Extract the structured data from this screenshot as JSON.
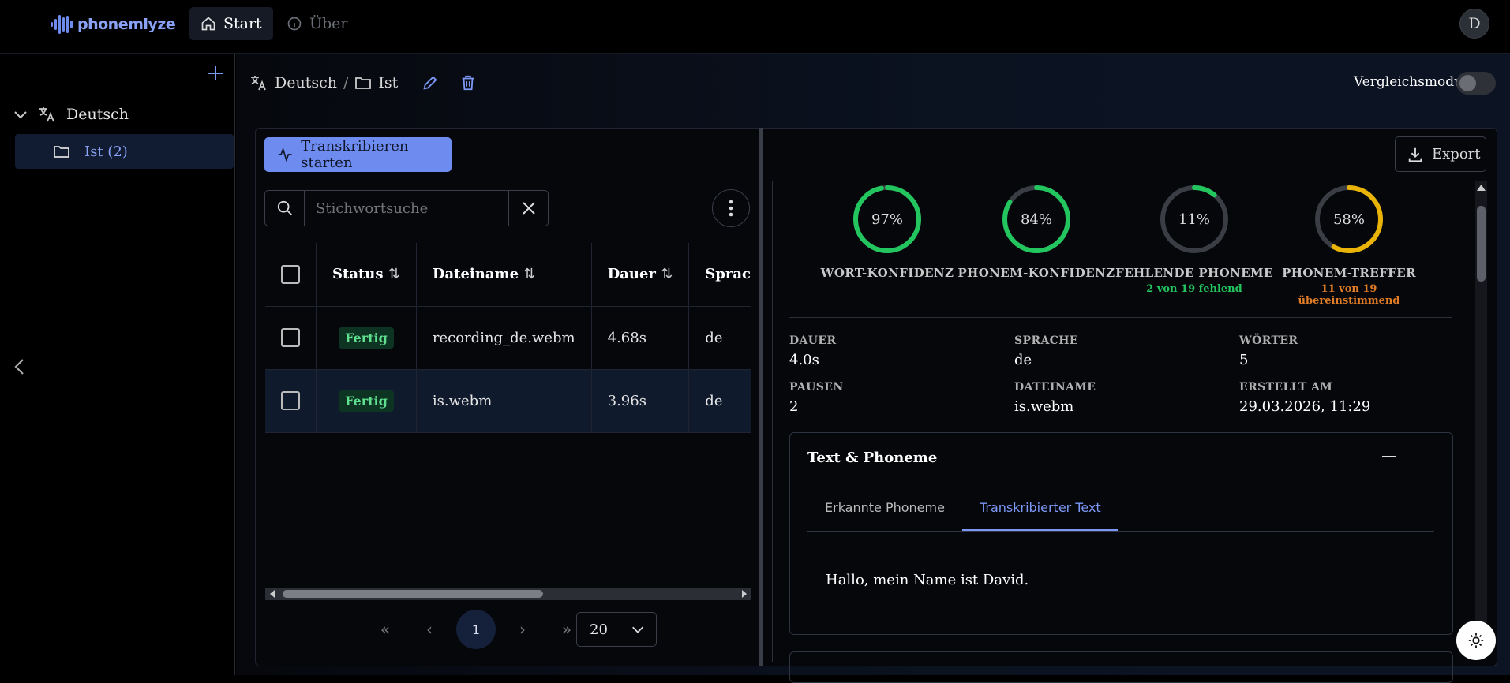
{
  "app": {
    "logo_text": "phonemlyze",
    "avatar_initial": "D"
  },
  "nav": {
    "start": "Start",
    "about": "Über"
  },
  "sidebar": {
    "language": "Deutsch",
    "folder_label": "Ist (2)"
  },
  "breadcrumb": {
    "language": "Deutsch",
    "separator": "/",
    "folder": "Ist"
  },
  "compare": {
    "label": "Vergleichsmodus",
    "enabled": false
  },
  "toolbar": {
    "transcribe_label": "Transkribieren starten",
    "search_placeholder": "Stichwortsuche"
  },
  "table": {
    "headers": [
      "Status",
      "Dateiname",
      "Dauer",
      "Sprache"
    ],
    "rows": [
      {
        "status": "Fertig",
        "filename": "recording_de.webm",
        "duration": "4.68s",
        "language": "de",
        "selected": false
      },
      {
        "status": "Fertig",
        "filename": "is.webm",
        "duration": "3.96s",
        "language": "de",
        "selected": true
      }
    ]
  },
  "pagination": {
    "current_page": "1",
    "page_size": "20"
  },
  "export_label": "Export",
  "gauges": [
    {
      "value": "97%",
      "fraction": 0.97,
      "label": "WORT-KONFIDENZ",
      "sub": "",
      "color": "#22c55e"
    },
    {
      "value": "84%",
      "fraction": 0.84,
      "label": "PHONEM-KONFIDENZ",
      "sub": "",
      "color": "#22c55e"
    },
    {
      "value": "11%",
      "fraction": 0.11,
      "label": "FEHLENDE PHONEME",
      "sub": "2 von 19 fehlend",
      "color": "#22c55e"
    },
    {
      "value": "58%",
      "fraction": 0.58,
      "label": "PHONEM-TREFFER",
      "sub": "11 von 19 übereinstimmend",
      "color": "#eab308"
    }
  ],
  "colors": {
    "accent": "#6e8bf0",
    "success": "#22c55e",
    "warning": "#eab308",
    "sub_orange": "#e07b26",
    "track": "#3a3d44"
  },
  "meta": {
    "duration_label": "DAUER",
    "duration": "4.0s",
    "language_label": "SPRACHE",
    "language": "de",
    "words_label": "WÖRTER",
    "words": "5",
    "pauses_label": "PAUSEN",
    "pauses": "2",
    "filename_label": "DATEINAME",
    "filename": "is.webm",
    "created_label": "ERSTELLT AM",
    "created": "29.03.2026, 11:29"
  },
  "card": {
    "title": "Text & Phoneme",
    "tabs": [
      "Erkannte Phoneme",
      "Transkribierter Text"
    ],
    "active_tab": 1,
    "text": "Hallo, mein Name ist David."
  }
}
